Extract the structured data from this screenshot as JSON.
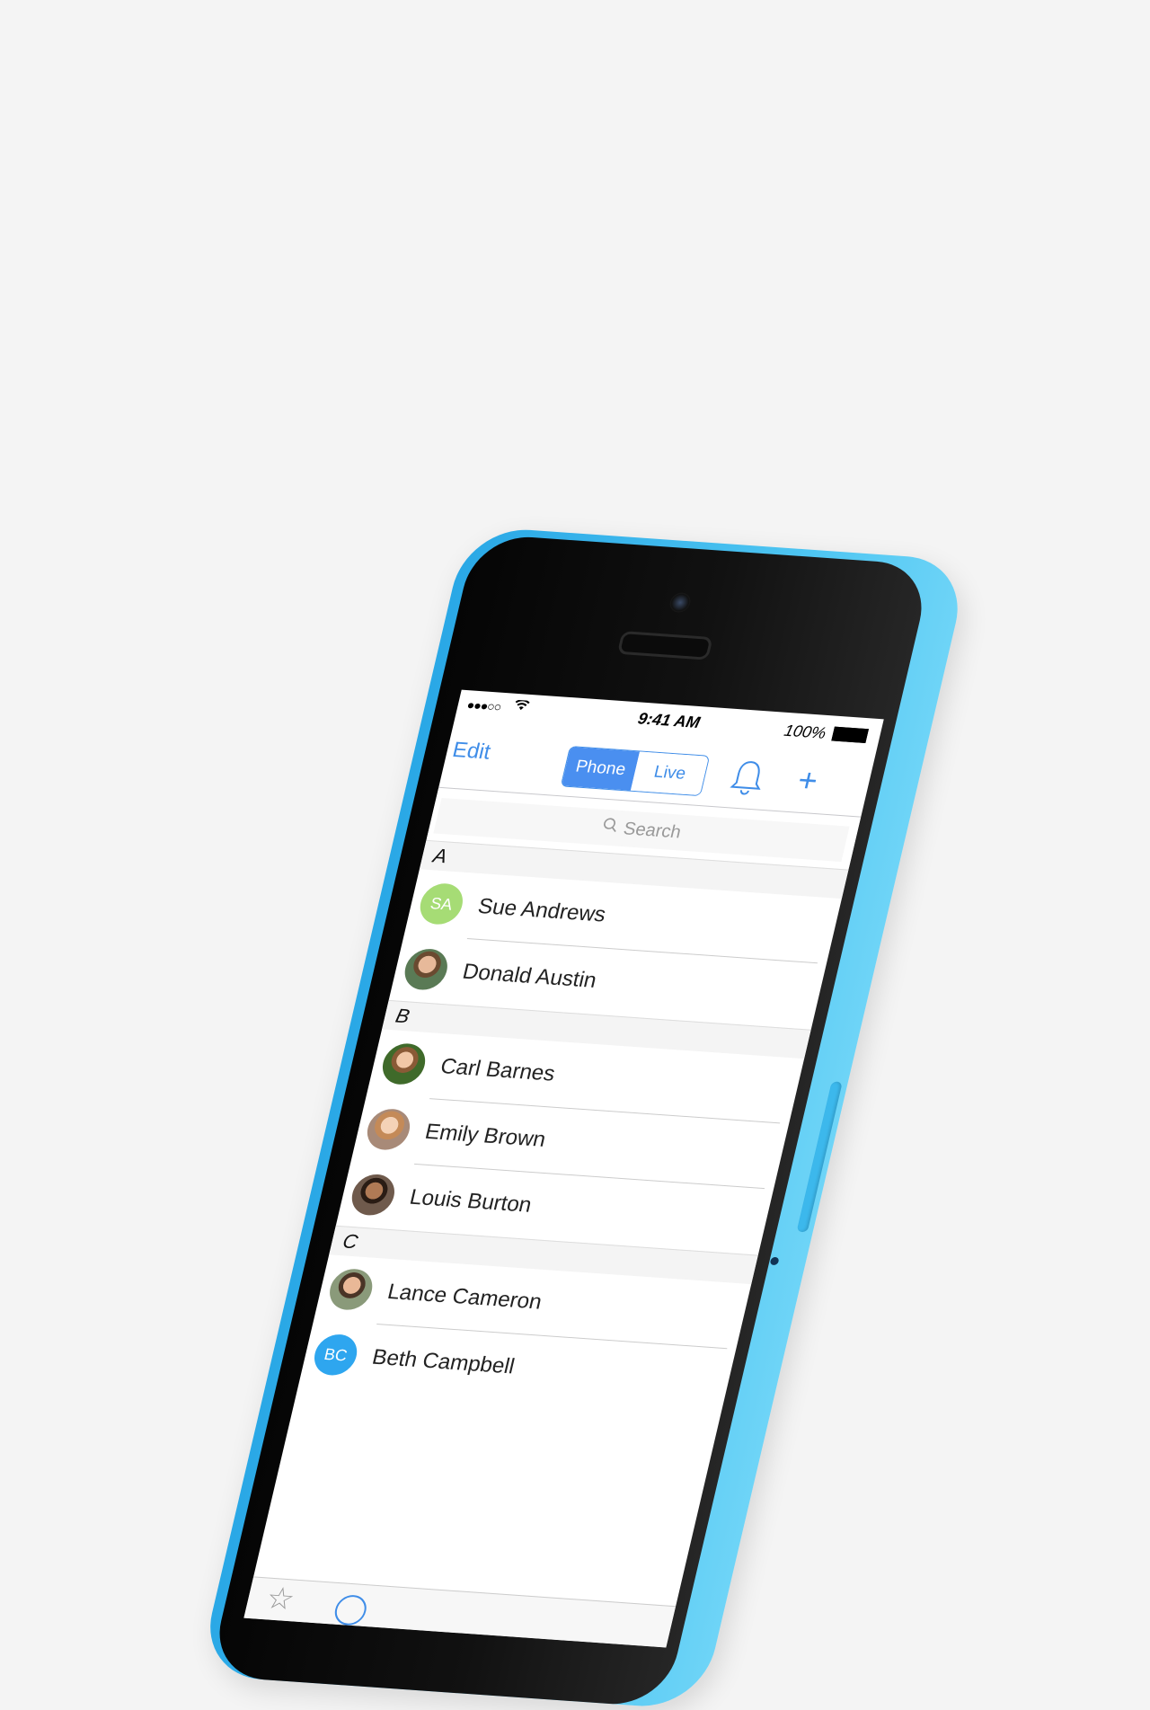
{
  "status_bar": {
    "signal": "●●●○○",
    "time": "9:41 AM",
    "battery": "100%"
  },
  "nav": {
    "edit_label": "Edit",
    "segments": [
      "Phone",
      "Live"
    ],
    "active_segment": "Phone"
  },
  "search": {
    "placeholder": "Search"
  },
  "sections": [
    {
      "letter": "A",
      "contacts": [
        {
          "name": "Sue Andrews",
          "initials": "SA",
          "color": "#a6dc75"
        },
        {
          "name": "Donald Austin"
        }
      ]
    },
    {
      "letter": "B",
      "contacts": [
        {
          "name": "Carl Barnes"
        },
        {
          "name": "Emily Brown"
        },
        {
          "name": "Louis Burton"
        }
      ]
    },
    {
      "letter": "C",
      "contacts": [
        {
          "name": "Lance Cameron"
        },
        {
          "name": "Beth Campbell",
          "initials": "BC",
          "color": "#2ea6ef"
        }
      ]
    }
  ],
  "colors": {
    "accent": "#3f8de8",
    "phone_body": "#3cb8ec",
    "background": "#f4f4f4"
  }
}
